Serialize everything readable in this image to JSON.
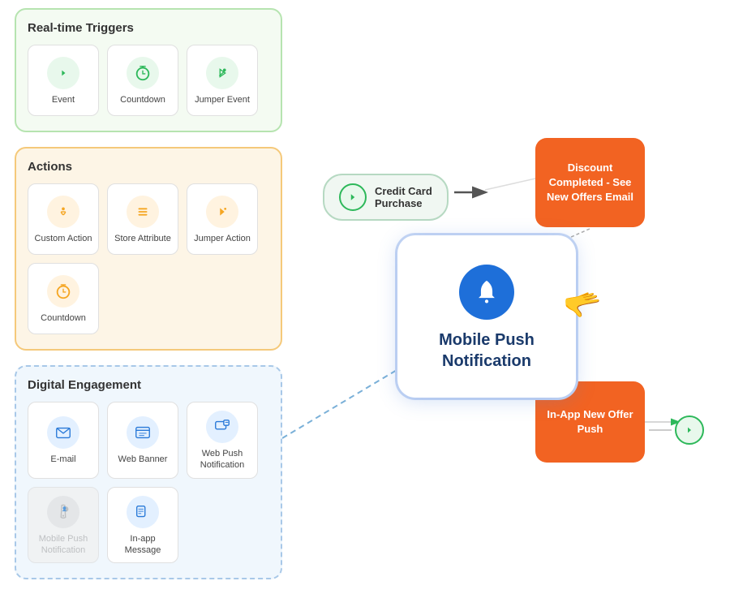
{
  "realtime_triggers": {
    "title": "Real-time Triggers",
    "items": [
      {
        "label": "Event",
        "icon": "🏃",
        "icon_class": "icon-green"
      },
      {
        "label": "Countdown",
        "icon": "⏱",
        "icon_class": "icon-green"
      },
      {
        "label": "Jumper Event",
        "icon": "🏃",
        "icon_class": "icon-green"
      }
    ]
  },
  "actions": {
    "title": "Actions",
    "items_row1": [
      {
        "label": "Custom Action",
        "icon": "👆",
        "icon_class": "icon-orange"
      },
      {
        "label": "Store Attribute",
        "icon": "≡",
        "icon_class": "icon-orange"
      },
      {
        "label": "Jumper Action",
        "icon": "🏃",
        "icon_class": "icon-orange"
      }
    ],
    "items_row2": [
      {
        "label": "Countdown",
        "icon": "⏱",
        "icon_class": "icon-orange"
      }
    ]
  },
  "digital_engagement": {
    "title": "Digital Engagement",
    "items_row1": [
      {
        "label": "E-mail",
        "icon": "✉",
        "icon_class": "icon-blue"
      },
      {
        "label": "Web Banner",
        "icon": "▤",
        "icon_class": "icon-blue"
      },
      {
        "label": "Web Push Notification",
        "icon": "🖥",
        "icon_class": "icon-blue"
      }
    ],
    "items_row2": [
      {
        "label": "Mobile Push Notification",
        "icon": "🔔",
        "icon_class": "icon-blue",
        "disabled": true
      },
      {
        "label": "In-app Message",
        "icon": "▤",
        "icon_class": "icon-blue"
      }
    ]
  },
  "flow": {
    "credit_card_node": {
      "label_line1": "Credit Card",
      "label_line2": "Purchase"
    },
    "discount_box": {
      "text": "Discount Completed - See New Offers Email"
    },
    "mobile_push": {
      "title": "Mobile Push Notification"
    },
    "inapp_box": {
      "text": "In-App New Offer Push"
    }
  }
}
